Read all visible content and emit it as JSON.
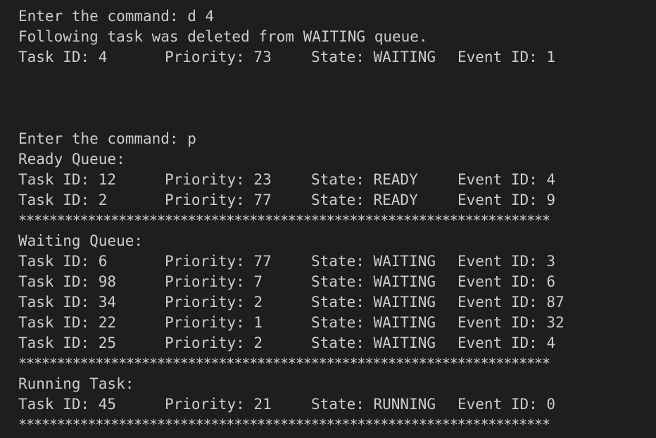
{
  "session": {
    "cmd_prompt": "Enter the command: ",
    "delete_cmd": "d 4",
    "delete_msg": "Following task was deleted from WAITING queue.",
    "deleted_task": {
      "id_label": "Task ID: 4",
      "priority_label": "Priority: 73",
      "state_label": "State: WAITING",
      "event_label": "Event ID: 1"
    },
    "print_cmd": "p",
    "separator": "*********************************************************************"
  },
  "ready": {
    "title": "Ready Queue:",
    "rows": [
      {
        "id": "Task ID: 12",
        "priority": "Priority: 23",
        "state": "State: READY",
        "event": "Event ID: 4"
      },
      {
        "id": "Task ID: 2",
        "priority": "Priority: 77",
        "state": "State: READY",
        "event": "Event ID: 9"
      }
    ]
  },
  "waiting": {
    "title": "Waiting Queue:",
    "rows": [
      {
        "id": "Task ID: 6",
        "priority": "Priority: 77",
        "state": "State: WAITING",
        "event": "Event ID: 3"
      },
      {
        "id": "Task ID: 98",
        "priority": "Priority: 7",
        "state": "State: WAITING",
        "event": "Event ID: 6"
      },
      {
        "id": "Task ID: 34",
        "priority": "Priority: 2",
        "state": "State: WAITING",
        "event": "Event ID: 87"
      },
      {
        "id": "Task ID: 22",
        "priority": "Priority: 1",
        "state": "State: WAITING",
        "event": "Event ID: 32"
      },
      {
        "id": "Task ID: 25",
        "priority": "Priority: 2",
        "state": "State: WAITING",
        "event": "Event ID: 4"
      }
    ]
  },
  "running": {
    "title": "Running Task:",
    "rows": [
      {
        "id": "Task ID: 45",
        "priority": "Priority: 21",
        "state": "State: RUNNING",
        "event": "Event ID: 0"
      }
    ]
  }
}
